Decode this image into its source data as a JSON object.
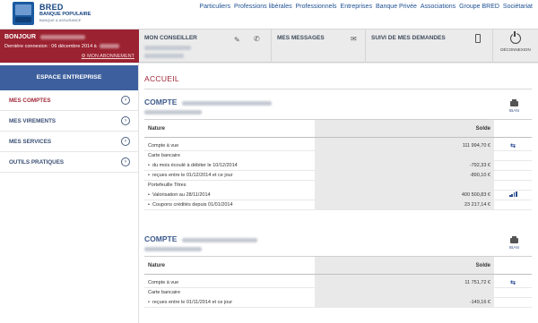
{
  "brand": {
    "line1": "BRED",
    "line2": "BANQUE POPULAIRE",
    "line3": "BANQUE & ASSURANCE"
  },
  "topnav": [
    "Particuliers",
    "Professions libérales",
    "Professionnels",
    "Entreprises",
    "Banque Privée",
    "Associations",
    "Groupe BRED",
    "Sociétariat"
  ],
  "header": {
    "bonjour": "BONJOUR",
    "last_connection": "Dernière connexion : 06 décembre 2014 à",
    "abonnement": "MON ABONNEMENT",
    "conseiller": "MON CONSEILLER",
    "messages": "MES MESSAGES",
    "demandes": "SUIVI DE MES DEMANDES",
    "deconnexion": "DÉCONNEXION"
  },
  "sidebar": {
    "title": "ESPACE ENTREPRISE",
    "items": [
      {
        "label": "MES COMPTES"
      },
      {
        "label": "MES VIREMENTS"
      },
      {
        "label": "MES SERVICES"
      },
      {
        "label": "OUTILS PRATIQUES"
      }
    ]
  },
  "main": {
    "page_title": "ACCUEIL",
    "accounts": [
      {
        "title": "COMPTE",
        "iban": "IBAN",
        "col_nature": "Nature",
        "col_solde": "Solde",
        "rows": {
          "r1_label": "Compte à vue",
          "r1_value": "111 994,70 €",
          "g1_label": "Carte bancaire",
          "r2_label": "du mois écoulé à débiter le 10/12/2014",
          "r2_value": "-792,33 €",
          "r3_label": "reçues entre le 01/12/2014 et ce jour",
          "r3_value": "-890,10 €",
          "g2_label": "Portefeuille Titres",
          "r4_label": "Valorisation au 28/11/2014",
          "r4_value": "400 500,83 €",
          "r5_label": "Coupons crédités depuis 01/01/2014",
          "r5_value": "23 217,14 €"
        }
      },
      {
        "title": "COMPTE",
        "iban": "IBAN",
        "col_nature": "Nature",
        "col_solde": "Solde",
        "rows": {
          "r1_label": "Compte à vue",
          "r1_value": "11 751,72 €",
          "g1_label": "Carte bancaire",
          "r2_label": "reçues entre le 01/11/2014 et ce jour",
          "r2_value": "-149,16 €"
        }
      }
    ]
  },
  "colors": {
    "brand_blue": "#14427f",
    "accent_red": "#9b2230",
    "sidebar_title_bg": "#3d5f9d"
  },
  "icons": [
    "edit-icon",
    "phone-icon",
    "mail-icon",
    "mobile-icon",
    "power-icon",
    "print-icon",
    "transfer-icon",
    "chart-bars-icon",
    "chevron-right-icon"
  ]
}
